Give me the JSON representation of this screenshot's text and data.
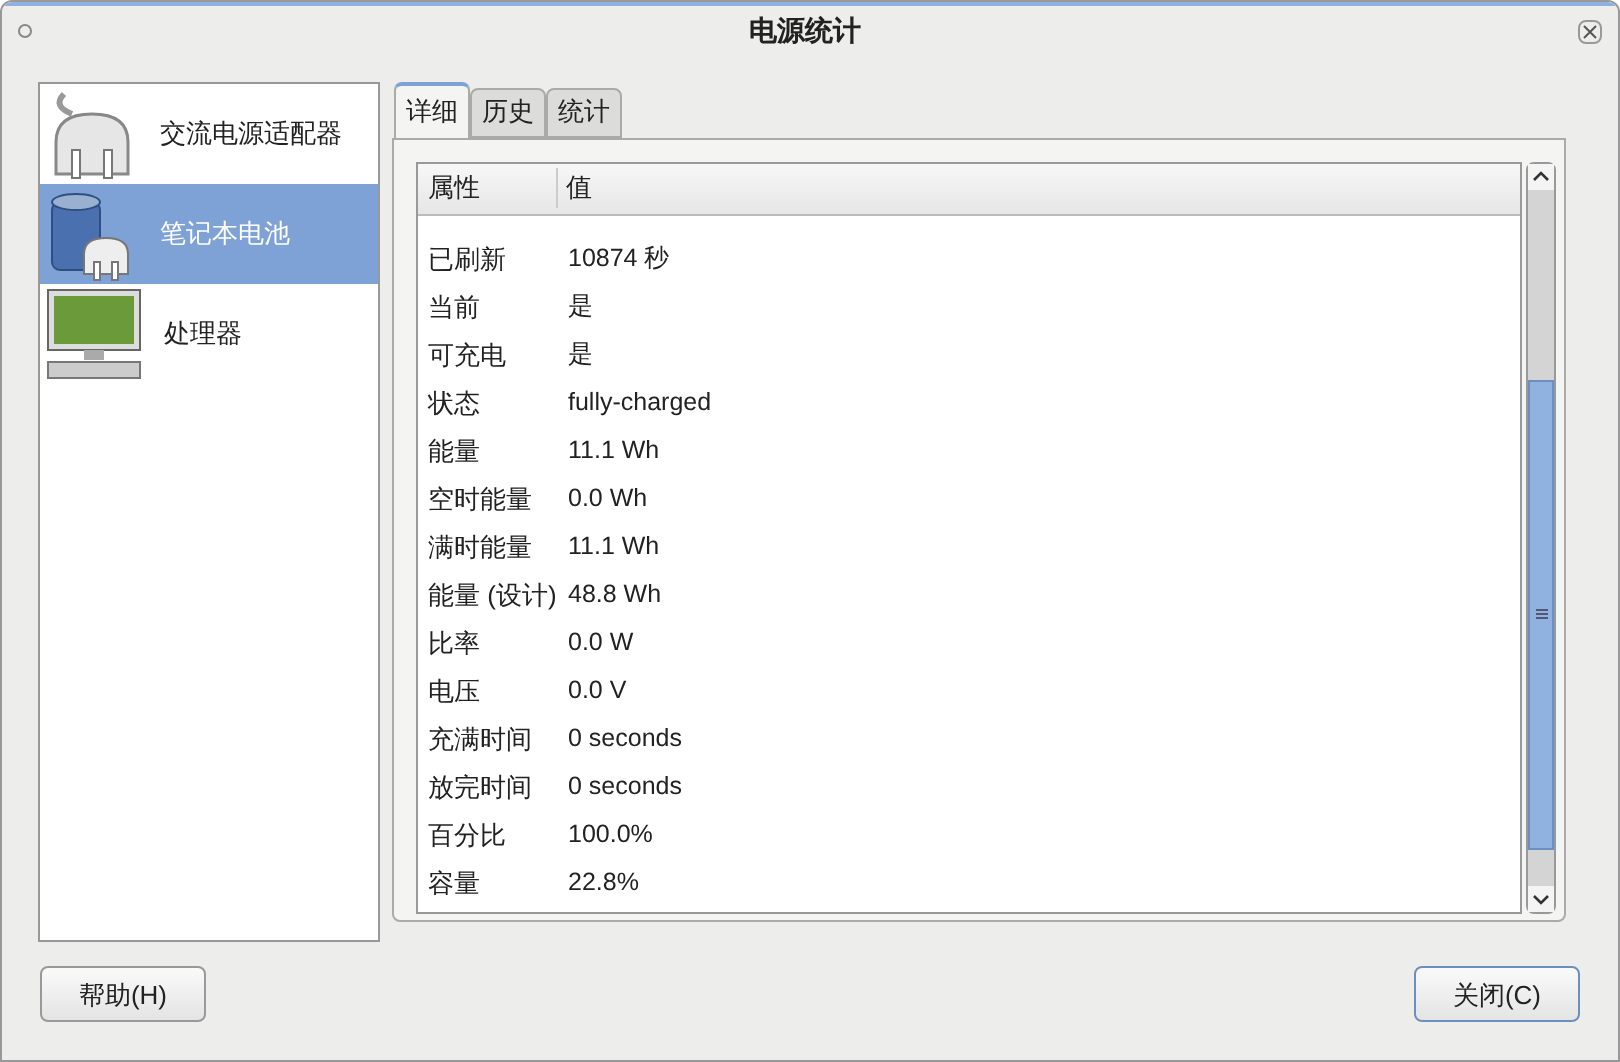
{
  "window": {
    "title": "电源统计"
  },
  "devices": [
    {
      "label": "交流电源适配器",
      "kind": "adapter",
      "selected": false
    },
    {
      "label": "笔记本电池",
      "kind": "battery",
      "selected": true
    },
    {
      "label": "处理器",
      "kind": "cpu",
      "selected": false
    }
  ],
  "tabs": [
    {
      "label": "详细",
      "selected": true
    },
    {
      "label": "历史",
      "selected": false
    },
    {
      "label": "统计",
      "selected": false
    }
  ],
  "table": {
    "columns": [
      "属性",
      "值"
    ],
    "rows": [
      [
        "已刷新",
        "10874 秒"
      ],
      [
        "当前",
        "是"
      ],
      [
        "可充电",
        "是"
      ],
      [
        "状态",
        "fully-charged"
      ],
      [
        "能量",
        "11.1 Wh"
      ],
      [
        "空时能量",
        "0.0 Wh"
      ],
      [
        "满时能量",
        "11.1 Wh"
      ],
      [
        "能量 (设计)",
        "48.8 Wh"
      ],
      [
        "比率",
        "0.0 W"
      ],
      [
        "电压",
        "0.0 V"
      ],
      [
        "充满时间",
        "0 seconds"
      ],
      [
        "放完时间",
        "0 seconds"
      ],
      [
        "百分比",
        "100.0%"
      ],
      [
        "容量",
        "22.8%"
      ]
    ]
  },
  "buttons": {
    "help": "帮助(H)",
    "close": "关闭(C)"
  }
}
